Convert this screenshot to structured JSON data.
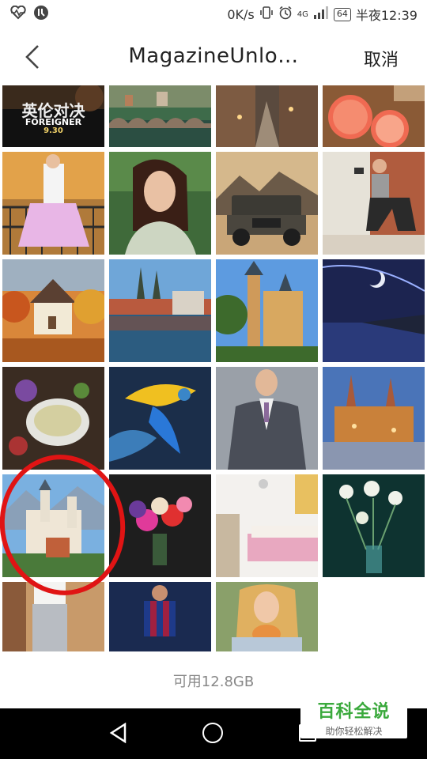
{
  "status_bar": {
    "speed": "0K/s",
    "network": "4G",
    "battery": "64",
    "time": "半夜12:39"
  },
  "header": {
    "title": "MagazineUnlo…",
    "cancel_label": "取消"
  },
  "tiles": {
    "foreigner": {
      "title": "英伦对决",
      "subtitle": "FOREIGNER",
      "date": "9.30"
    }
  },
  "storage_text": "可用12.8GB",
  "watermark": {
    "main": "百科全说",
    "sub": "助你轻松解决"
  },
  "colors": {
    "annotation_circle": "#e01414",
    "watermark_green": "#3aa93c"
  }
}
